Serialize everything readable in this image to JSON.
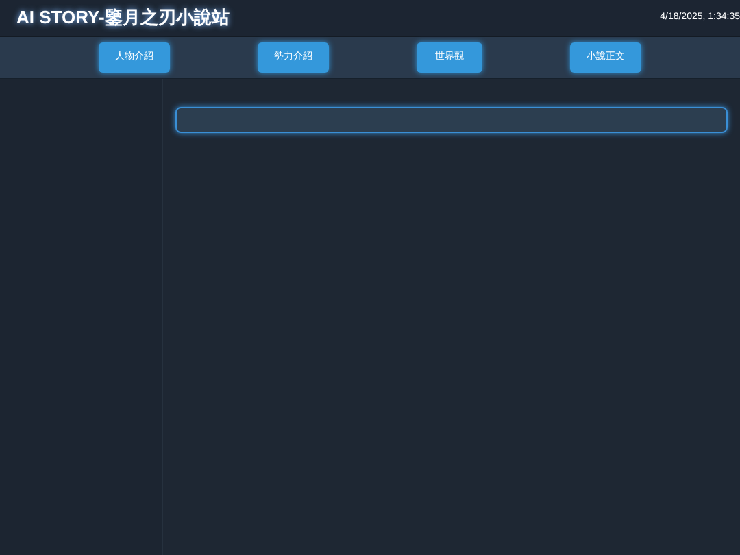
{
  "header": {
    "title": "AI STORY-鑒月之刃小說站",
    "timestamp": "4/18/2025, 1:34:35"
  },
  "nav": [
    {
      "label": "人物介紹"
    },
    {
      "label": "勢力介紹"
    },
    {
      "label": "世界觀"
    },
    {
      "label": "小說正文"
    }
  ],
  "content": {
    "kind": "field"
  }
}
